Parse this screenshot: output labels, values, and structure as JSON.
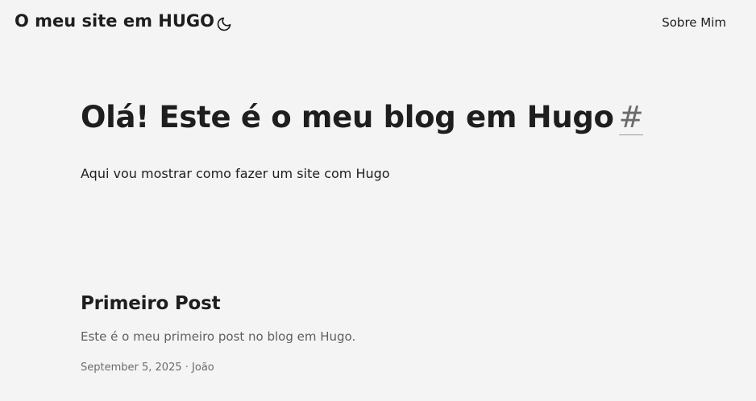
{
  "header": {
    "site_title": "O meu site em HUGO",
    "theme_toggle_icon": "moon-icon",
    "nav": [
      {
        "label": "Sobre Mim"
      }
    ]
  },
  "hero": {
    "title": "Olá! Este é o meu blog em Hugo",
    "anchor": "#",
    "description": "Aqui vou mostrar como fazer um site com Hugo"
  },
  "posts": [
    {
      "title": "Primeiro Post",
      "summary": "Este é o meu primeiro post no blog em Hugo.",
      "date": "September 5, 2025",
      "separator": "·",
      "author": "João"
    }
  ],
  "colors": {
    "background": "#f4f4f4",
    "text": "#1e1e1e",
    "secondary_text": "#5f5f5f"
  }
}
